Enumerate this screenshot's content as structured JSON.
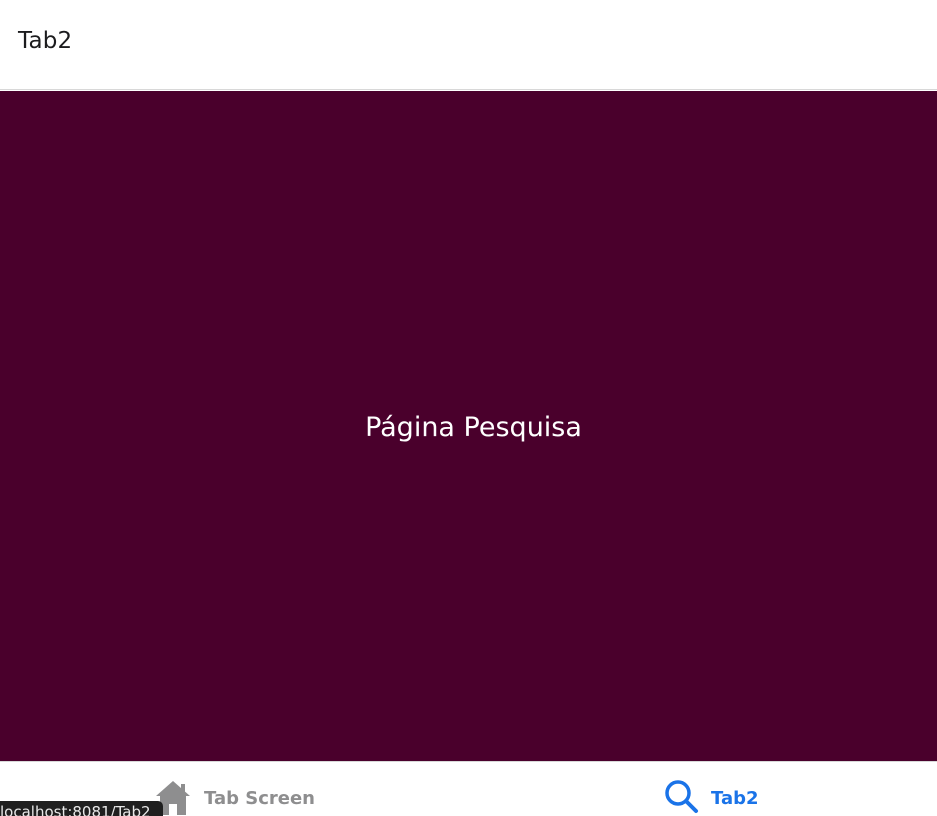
{
  "header": {
    "title": "Tab2"
  },
  "content": {
    "text": "Página Pesquisa",
    "background_color": "#4a002c"
  },
  "tabbar": {
    "tabs": [
      {
        "label": "Tab Screen",
        "icon": "home-icon",
        "active": false,
        "color": "#8e8e8f"
      },
      {
        "label": "Tab2",
        "icon": "search-icon",
        "active": true,
        "color": "#1a73e8"
      }
    ]
  },
  "status_tooltip": {
    "text": "localhost:8081/Tab2"
  }
}
